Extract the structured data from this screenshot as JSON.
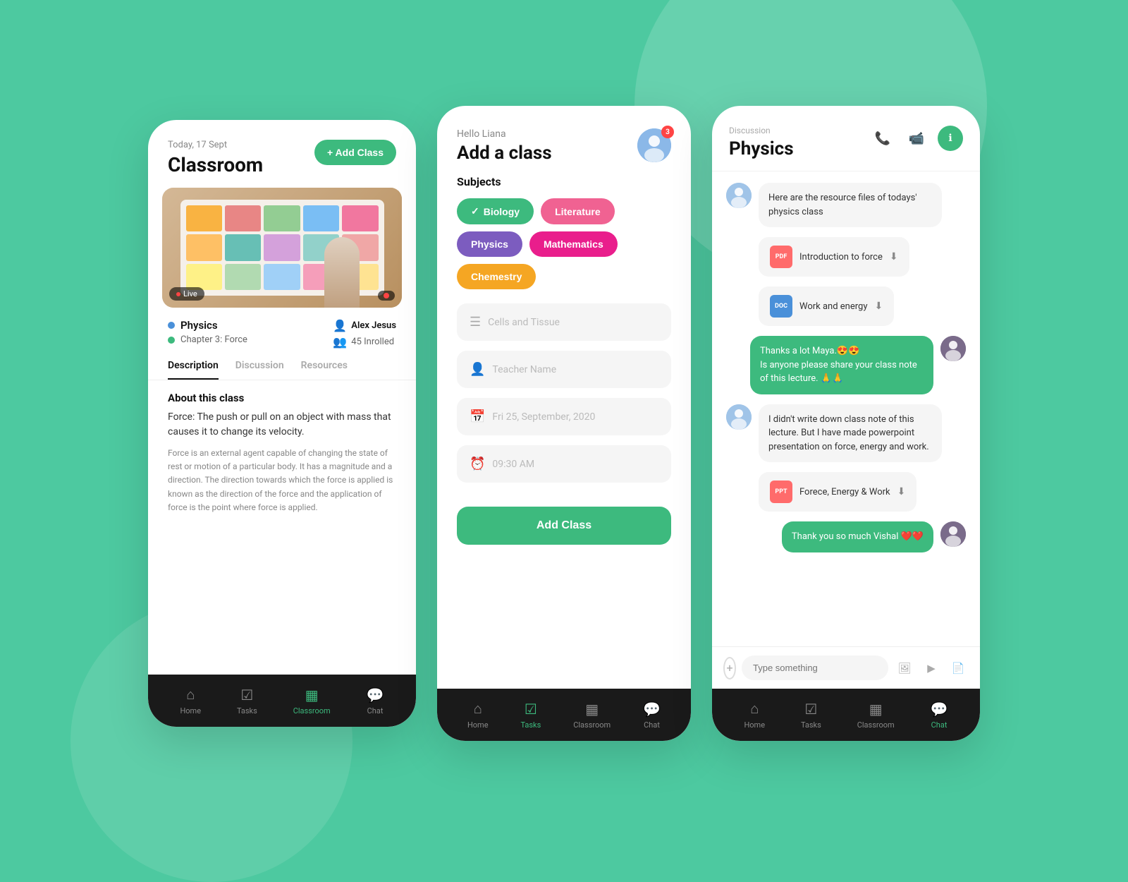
{
  "background": "#4dc9a0",
  "card1": {
    "date": "Today, 17 Sept",
    "title": "Classroom",
    "add_class_btn": "+ Add Class",
    "subject": "Physics",
    "chapter": "Chapter 3: Force",
    "teacher": "Alex Jesus",
    "enrolled": "45 Inrolled",
    "live_badge": "Live",
    "tabs": [
      "Description",
      "Discussion",
      "Resources"
    ],
    "active_tab": "Description",
    "about_title": "About this class",
    "about_main": "Force: The push or pull on an object with mass that causes it to change its velocity.",
    "about_secondary": "Force is an external agent capable of changing the state of rest or motion of a particular body. It has a magnitude and a direction. The direction towards which the force is applied is known as the direction of the force and the application of force is the point where force is applied.",
    "nav_items": [
      "Home",
      "Tasks",
      "Classroom",
      "Chat"
    ],
    "active_nav": "Classroom"
  },
  "card2": {
    "hello": "Hello Liana",
    "title": "Add a class",
    "notification_count": "3",
    "subjects_label": "Subjects",
    "subjects": [
      {
        "label": "Biology",
        "color": "green",
        "checked": true
      },
      {
        "label": "Literature",
        "color": "pink"
      },
      {
        "label": "Physics",
        "color": "purple"
      },
      {
        "label": "Mathematics",
        "color": "hot-pink"
      },
      {
        "label": "Chemestry",
        "color": "orange"
      }
    ],
    "cells_placeholder": "Cells and Tissue",
    "teacher_placeholder": "Teacher Name",
    "date_placeholder": "Fri 25, September, 2020",
    "time_placeholder": "09:30 AM",
    "add_class_btn": "Add Class",
    "nav_items": [
      "Home",
      "Tasks",
      "Classroom",
      "Chat"
    ],
    "active_nav": "Tasks"
  },
  "card3": {
    "discussion_label": "Discussion",
    "title": "Physics",
    "messages": [
      {
        "id": 1,
        "side": "left",
        "text": "Here are the resource files of todays' physics class",
        "type": "text"
      },
      {
        "id": 2,
        "side": "left",
        "text": "Introduction to force",
        "type": "file-pdf"
      },
      {
        "id": 3,
        "side": "left",
        "text": "Work and energy",
        "type": "file-doc"
      },
      {
        "id": 4,
        "side": "right",
        "text": "Thanks a lot Maya.😍😍\nIs anyone please share your class note of this lecture. 🙏🙏",
        "type": "text"
      },
      {
        "id": 5,
        "side": "left",
        "text": "I didn't write down class note of this lecture. But I have made powerpoint presentation on force, energy and work.",
        "type": "text"
      },
      {
        "id": 6,
        "side": "left",
        "text": "Forece, Energy & Work",
        "type": "file-ppt"
      },
      {
        "id": 7,
        "side": "right",
        "text": "Thank you so much Vishal ❤️❤️",
        "type": "text"
      }
    ],
    "type_placeholder": "Type something",
    "nav_items": [
      "Home",
      "Tasks",
      "Classroom",
      "Chat"
    ],
    "active_nav": "Chat"
  }
}
